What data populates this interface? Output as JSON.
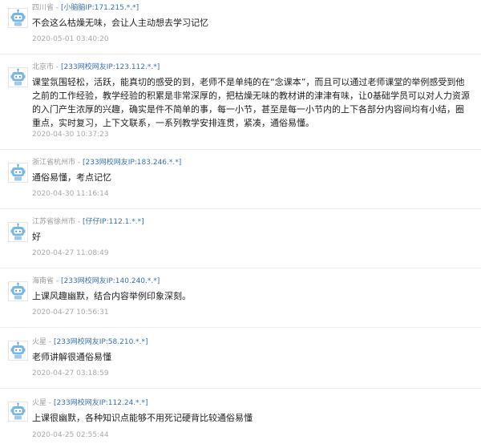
{
  "comments": [
    {
      "region": "四川省",
      "separator": " - ",
      "user": "[小脑脑IP:171.215.*.*]",
      "content": "不会这么枯燥无味，会让人主动想去学习记忆",
      "time": "2020-05-01 03:40:20"
    },
    {
      "region": "北京市",
      "separator": " - ",
      "user": "[233网校网友IP:123.112.*.*]",
      "content": "课堂氛围轻松，活跃，能真切的感受的到，老师不是单纯的在“念课本”，而且可以通过老师课堂的举例感受到他之前的工作经验，教学经验的积累是非常深厚的，把枯燥无味的教材讲的津津有味，让0基础学员可以对人力资源的入门产生浓厚的兴趣，确实是件不简单的事，每一小节，甚至是每一小节内的上下各部分内容间均有小结，圈重点，实时复习，上下文联系，一系列教学安排连贯，紧凑，通俗易懂。",
      "time": "2020-04-30 10:37:23"
    },
    {
      "region": "浙江省杭州市",
      "separator": " - ",
      "user": "[233网校网友IP:183.246.*.*]",
      "content": "通俗易懂，考点记忆",
      "time": "2020-04-30 11:16:14"
    },
    {
      "region": "江苏省徐州市",
      "separator": " - ",
      "user": "[仔仔IP:112.1.*.*]",
      "content": "好",
      "time": "2020-04-27 11:08:49"
    },
    {
      "region": "海南省",
      "separator": " - ",
      "user": "[233网校网友IP:140.240.*.*]",
      "content": "上课风趣幽默，结合内容举例印象深刻。",
      "time": "2020-04-27 10:56:31"
    },
    {
      "region": "火星",
      "separator": " - ",
      "user": "[233网校网友IP:58.210.*.*]",
      "content": "老师讲解很通俗易懂",
      "time": "2020-04-27 03:18:59"
    },
    {
      "region": "火星",
      "separator": " - ",
      "user": "[233网校网友IP:112.24.*.*]",
      "content": "上课很幽默，各种知识点能够不用死记硬背比较通俗易懂",
      "time": "2020-04-25 02:55:44"
    }
  ]
}
